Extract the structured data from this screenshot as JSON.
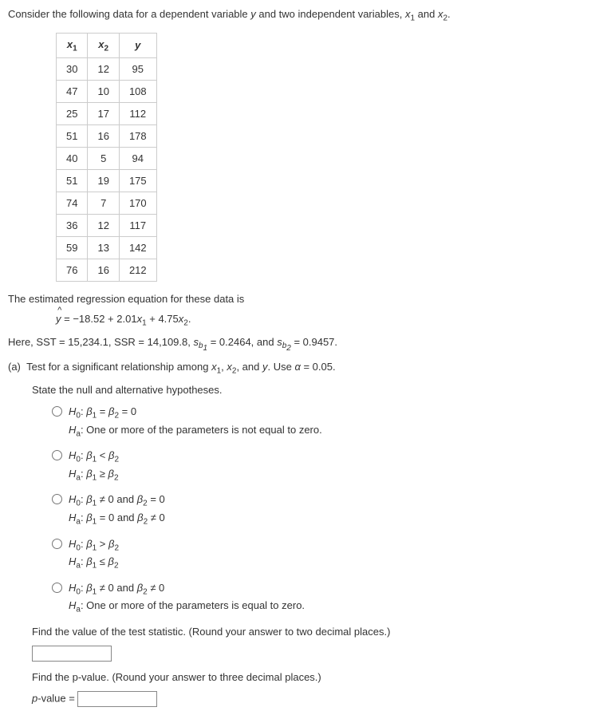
{
  "intro": "Consider the following data for a dependent variable y and two independent variables, x₁ and x₂.",
  "table": {
    "headers": [
      "x₁",
      "x₂",
      "y"
    ],
    "rows": [
      [
        "30",
        "12",
        "95"
      ],
      [
        "47",
        "10",
        "108"
      ],
      [
        "25",
        "17",
        "112"
      ],
      [
        "51",
        "16",
        "178"
      ],
      [
        "40",
        "5",
        "94"
      ],
      [
        "51",
        "19",
        "175"
      ],
      [
        "74",
        "7",
        "170"
      ],
      [
        "36",
        "12",
        "117"
      ],
      [
        "59",
        "13",
        "142"
      ],
      [
        "76",
        "16",
        "212"
      ]
    ]
  },
  "estimated_text": "The estimated regression equation for these data is",
  "equation": "ŷ = −18.52 + 2.01x₁ + 4.75x₂.",
  "here_text": "Here, SST = 15,234.1, SSR = 14,109.8, s_{b₁} = 0.2464, and s_{b₂} = 0.9457.",
  "part_a": "(a)  Test for a significant relationship among x₁, x₂, and y. Use α = 0.05.",
  "state_hyp": "State the null and alternative hypotheses.",
  "options": [
    {
      "h0": "H₀: β₁ = β₂ = 0",
      "ha": "Hₐ: One or more of the parameters is not equal to zero."
    },
    {
      "h0": "H₀: β₁ < β₂",
      "ha": "Hₐ: β₁ ≥ β₂"
    },
    {
      "h0": "H₀: β₁ ≠ 0 and β₂ = 0",
      "ha": "Hₐ: β₁ = 0 and β₂ ≠ 0"
    },
    {
      "h0": "H₀: β₁ > β₂",
      "ha": "Hₐ: β₁ ≤ β₂"
    },
    {
      "h0": "H₀: β₁ ≠ 0 and β₂ ≠ 0",
      "ha": "Hₐ: One or more of the parameters is equal to zero."
    }
  ],
  "find_stat": "Find the value of the test statistic. (Round your answer to two decimal places.)",
  "find_p": "Find the p-value. (Round your answer to three decimal places.)",
  "p_label": "p-value ="
}
